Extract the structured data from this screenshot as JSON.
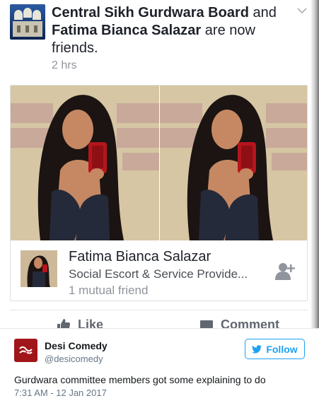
{
  "facebook_story": {
    "actor_page": "Central Sikh Gurdwara Board",
    "connector": "and",
    "friend_name": "Fatima Bianca Salazar",
    "suffix": "are now friends.",
    "timestamp": "2 hrs",
    "icons": {
      "page_avatar": "gurdwara-building-avatar",
      "menu": "chevron-down-icon"
    }
  },
  "profile_card": {
    "name": "Fatima Bianca Salazar",
    "subtitle": "Social Escort & Service Provide...",
    "mutual": "1 mutual friend",
    "add_icon": "add-friend-icon"
  },
  "actions": {
    "like_label": "Like",
    "comment_label": "Comment"
  },
  "tweet": {
    "display_name": "Desi Comedy",
    "handle": "@desicomedy",
    "follow_label": "Follow",
    "text": "Gurdwara committee members got some explaining to do",
    "date": "7:31 AM - 12 Jan 2017",
    "avatar_icon": "desi-comedy-logo",
    "follow_icon": "twitter-bird-icon",
    "colors": {
      "follow_blue": "#1da1f2",
      "avatar_red": "#a1161a"
    }
  }
}
